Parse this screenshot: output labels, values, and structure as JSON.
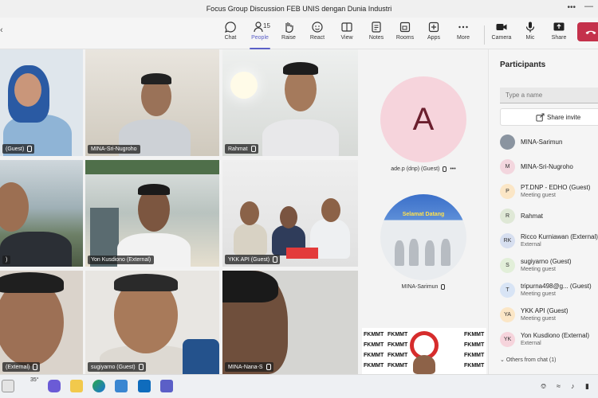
{
  "window": {
    "title": "Focus Group Discussion FEB UNIS dengan Dunia Industri",
    "more": "•••",
    "minimize": "—",
    "left_glyph": "‹"
  },
  "toolbar": {
    "chat": "Chat",
    "people": "People",
    "people_count": "15",
    "raise": "Raise",
    "react": "React",
    "view": "View",
    "notes": "Notes",
    "rooms": "Rooms",
    "apps": "Apps",
    "more": "More",
    "camera": "Camera",
    "mic": "Mic",
    "share": "Share"
  },
  "tiles": [
    {
      "name": "(Guest)"
    },
    {
      "name": "MINA-Sri-Nugroho"
    },
    {
      "name": "Rahmat"
    },
    {
      "name": ")"
    },
    {
      "name": "Yon Kusdiono (External)"
    },
    {
      "name": "YKK API (Guest)"
    },
    {
      "name": "(External)"
    },
    {
      "name": "sugiyarno (Guest)"
    },
    {
      "name": "MINA-Nana-S"
    }
  ],
  "side_tiles": {
    "avatar_letter": "A",
    "avatar_name": "ade.p (dnp) (Guest)",
    "banner_name": "MINA-Sarimun",
    "banner_heading": "Selamat Datang",
    "fkmmt_word": "FKMMT",
    "more_glyph": "•••"
  },
  "panel": {
    "title": "Participants",
    "search_placeholder": "Type a name",
    "share_invite": "Share invite",
    "participants": [
      {
        "name": "MINA-Sarimun",
        "sub": "",
        "initials": "",
        "color": "#8a94a0"
      },
      {
        "name": "MINA-Sri-Nugroho",
        "sub": "",
        "initials": "M",
        "color": "#f3d6de"
      },
      {
        "name": "PT.DNP - EDHO (Guest)",
        "sub": "Meeting guest",
        "initials": "P",
        "color": "#fbe6c6"
      },
      {
        "name": "Rahmat",
        "sub": "",
        "initials": "R",
        "color": "#dfe8d6"
      },
      {
        "name": "Ricco Kurniawan (External)",
        "sub": "External",
        "initials": "RK",
        "color": "#d7dff0"
      },
      {
        "name": "sugiyarno (Guest)",
        "sub": "Meeting guest",
        "initials": "S",
        "color": "#e2efd9"
      },
      {
        "name": "tripurna498@g...   (Guest)",
        "sub": "Meeting guest",
        "initials": "T",
        "color": "#d8e4f5"
      },
      {
        "name": "YKK API (Guest)",
        "sub": "Meeting guest",
        "initials": "YA",
        "color": "#fbe6c6"
      },
      {
        "name": "Yon Kusdiono (External)",
        "sub": "External",
        "initials": "YK",
        "color": "#f6d4dc"
      }
    ],
    "others": "Others from chat (1)"
  },
  "taskbar": {
    "temperature": "35°"
  },
  "colors": {
    "accent": "#5b5fc7",
    "leave": "#c4314b",
    "avatar_bg": "#f6d4dc"
  }
}
